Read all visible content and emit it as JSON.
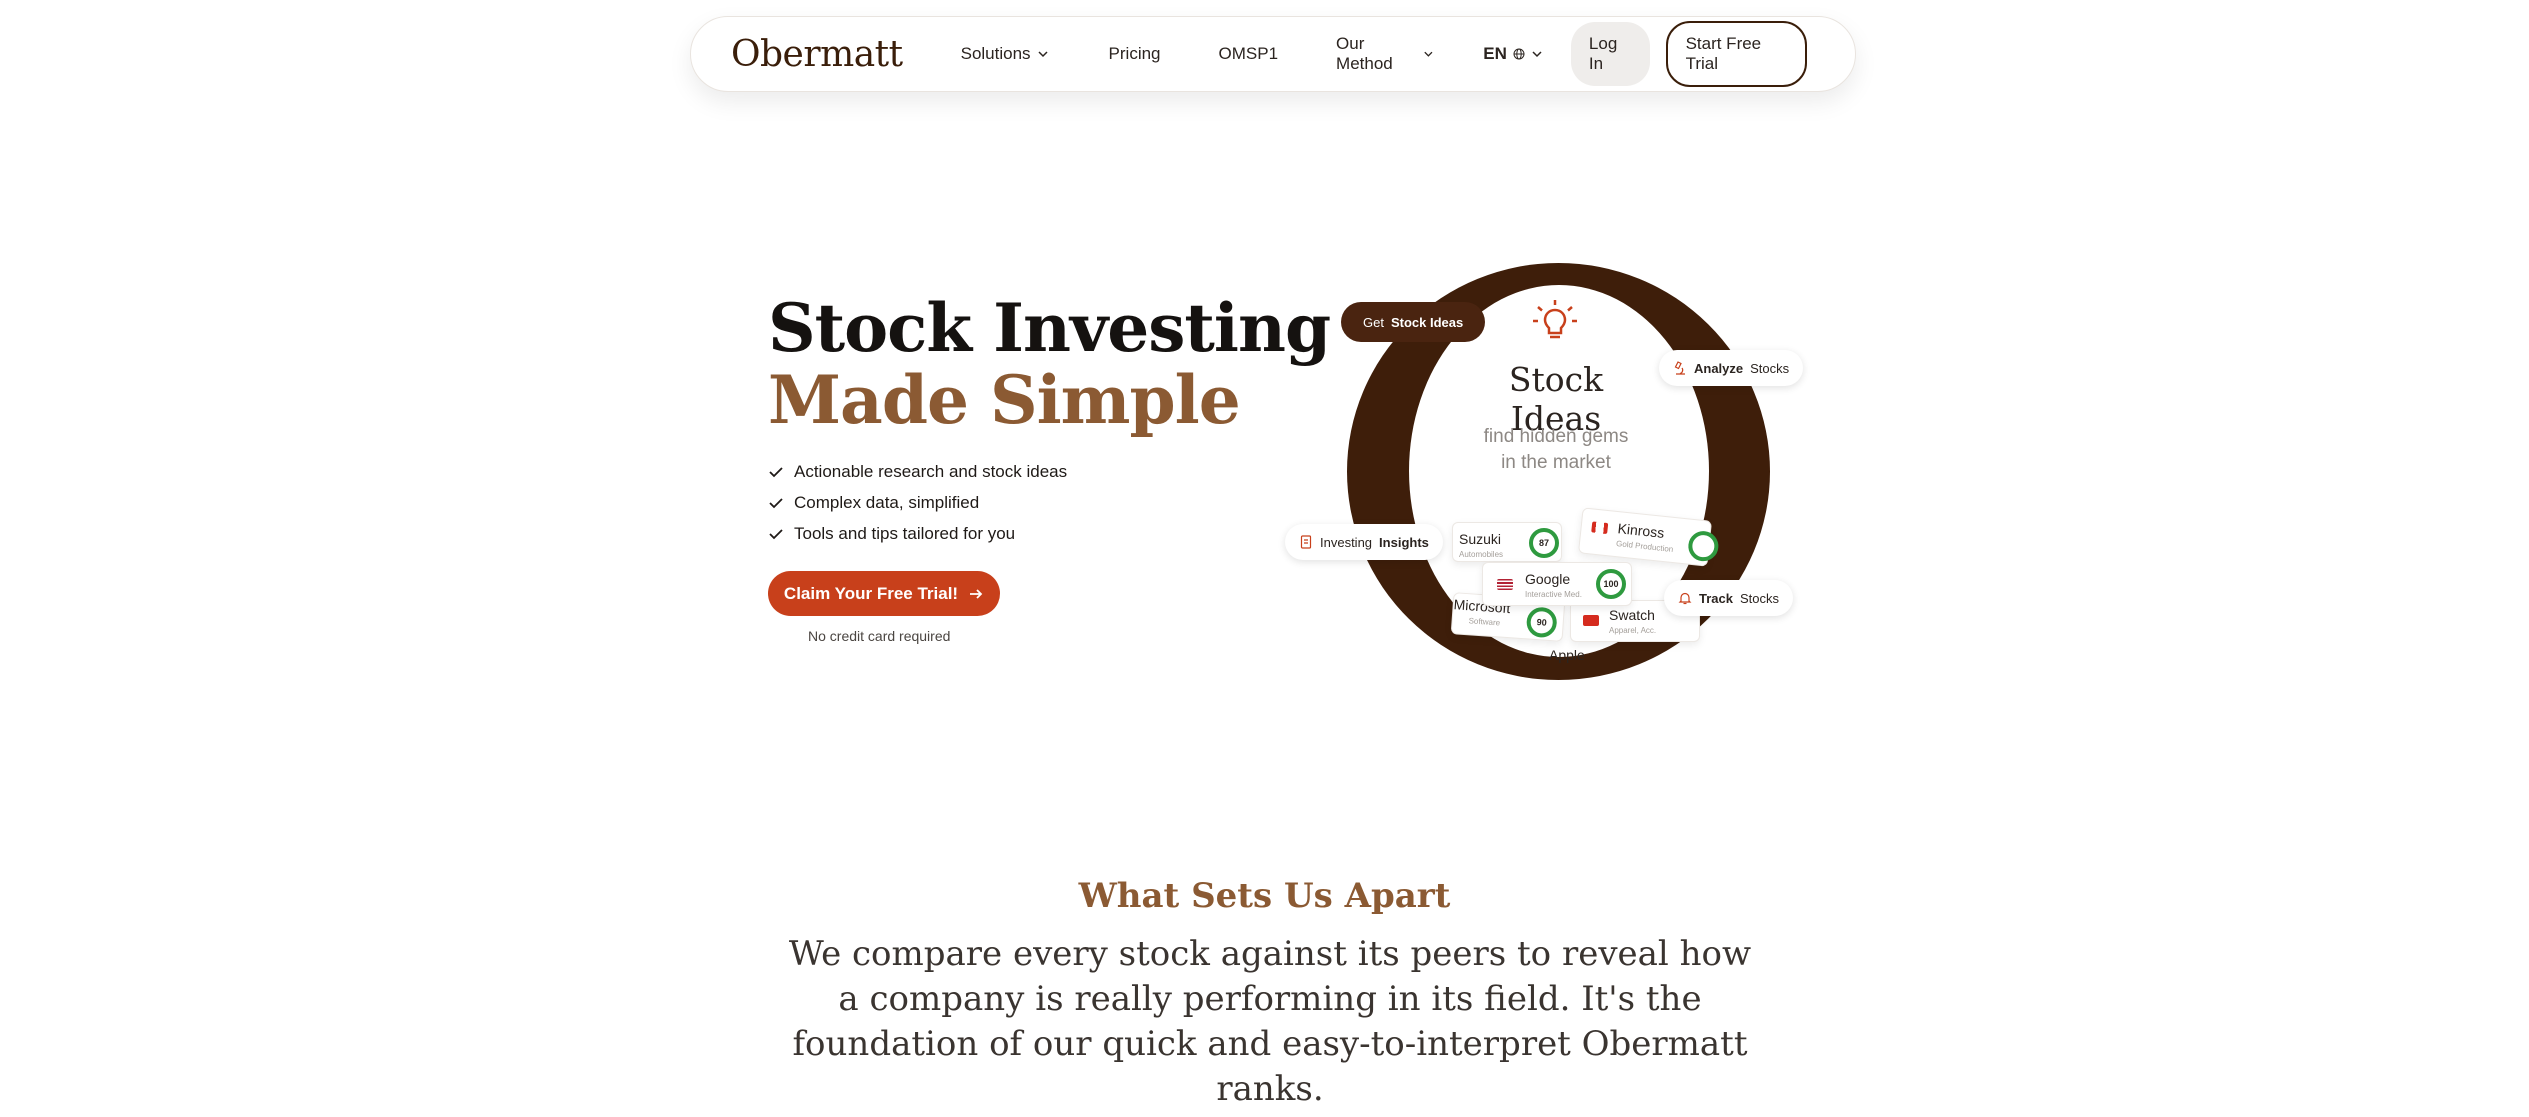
{
  "nav": {
    "logo": "Obermatt",
    "solutions": "Solutions",
    "pricing": "Pricing",
    "omsp": "OMSP1",
    "method": "Our Method",
    "lang": "EN",
    "login": "Log In",
    "trial": "Start Free Trial"
  },
  "hero": {
    "title_line1": "Stock Investing",
    "title_line2": "Made Simple",
    "checks": [
      "Actionable research and stock ideas",
      "Complex data, simplified",
      "Tools and tips tailored for you"
    ],
    "cta": "Claim Your Free Trial!",
    "cta_note": "No credit card required"
  },
  "illustration": {
    "title": "Stock Ideas",
    "subtitle_line1": "find hidden gems",
    "subtitle_line2": "in the market",
    "pill_ideas_pre": "Get",
    "pill_ideas_bold": "Stock Ideas",
    "pill_analyze_bold": "Analyze",
    "pill_analyze_post": "Stocks",
    "pill_insights_pre": "Investing",
    "pill_insights_bold": "Insights",
    "pill_track_bold": "Track",
    "pill_track_post": "Stocks",
    "cards": [
      {
        "name": "Suzuki",
        "sub": "Automobiles",
        "score": "87"
      },
      {
        "name": "Kinross",
        "sub": "Gold Production",
        "score": ""
      },
      {
        "name": "Google",
        "sub": "Interactive Med.",
        "score": "100"
      },
      {
        "name": "Microsoft",
        "sub": "Software",
        "score": "90"
      },
      {
        "name": "Swatch",
        "sub": "Apparel, Acc.",
        "score": ""
      },
      {
        "name": "Apple",
        "sub": "",
        "score": ""
      }
    ],
    "colors": {
      "ring": "#3e1e0a",
      "accent": "#c8401b",
      "score": "#2e9a3f"
    }
  },
  "section2": {
    "title": "What Sets Us Apart",
    "body": "We compare every stock against its peers to reveal how a company is really performing in its field. It's the foundation of our quick and easy-to-interpret Obermatt ranks."
  }
}
